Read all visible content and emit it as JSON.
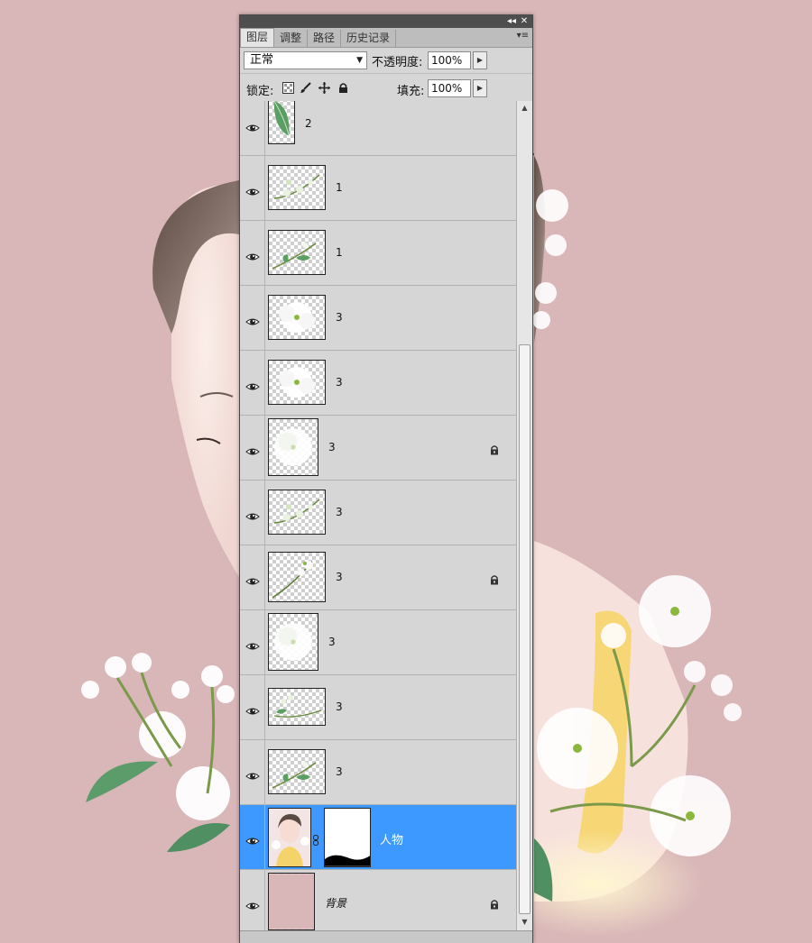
{
  "panel": {
    "title_buttons": {
      "collapse": "◂◂",
      "close": "✕"
    },
    "tabs": [
      {
        "label": "图层",
        "active": true
      },
      {
        "label": "调整",
        "active": false
      },
      {
        "label": "路径",
        "active": false
      },
      {
        "label": "历史记录",
        "active": false
      }
    ],
    "tab_menu": "▾≡",
    "blend_mode": "正常",
    "opacity_label": "不透明度:",
    "opacity_value": "100%",
    "lock_label": "锁定:",
    "fill_label": "填充:",
    "fill_value": "100%",
    "lock_icons": [
      "lock-transparent-pixels-icon",
      "lock-image-pixels-icon",
      "lock-position-icon",
      "lock-all-icon"
    ]
  },
  "layers": [
    {
      "name": "2",
      "thumb": "leaf",
      "locked": false,
      "selected": false
    },
    {
      "name": "1",
      "thumb": "branch-buds",
      "locked": false,
      "selected": false
    },
    {
      "name": "1",
      "thumb": "branch-leaves",
      "locked": false,
      "selected": false
    },
    {
      "name": "3",
      "thumb": "flower-white",
      "locked": false,
      "selected": false
    },
    {
      "name": "3",
      "thumb": "flower-white",
      "locked": false,
      "selected": false
    },
    {
      "name": "3",
      "thumb": "flower-glow",
      "locked": true,
      "selected": false
    },
    {
      "name": "3",
      "thumb": "branch-buds",
      "locked": false,
      "selected": false
    },
    {
      "name": "3",
      "thumb": "branch-stem",
      "locked": true,
      "selected": false
    },
    {
      "name": "3",
      "thumb": "flower-glow",
      "locked": false,
      "selected": false
    },
    {
      "name": "3",
      "thumb": "branch-small",
      "locked": false,
      "selected": false
    },
    {
      "name": "3",
      "thumb": "branch-leaves",
      "locked": false,
      "selected": false
    },
    {
      "name": "人物",
      "thumb": "portrait",
      "locked": false,
      "selected": true
    },
    {
      "name": "背景",
      "thumb": "solid-pink",
      "locked": true,
      "selected": false
    }
  ],
  "colors": {
    "canvas_bg": "#d9b6b8",
    "panel_bg": "#d6d6d6",
    "selected_layer": "#3d98ff"
  }
}
